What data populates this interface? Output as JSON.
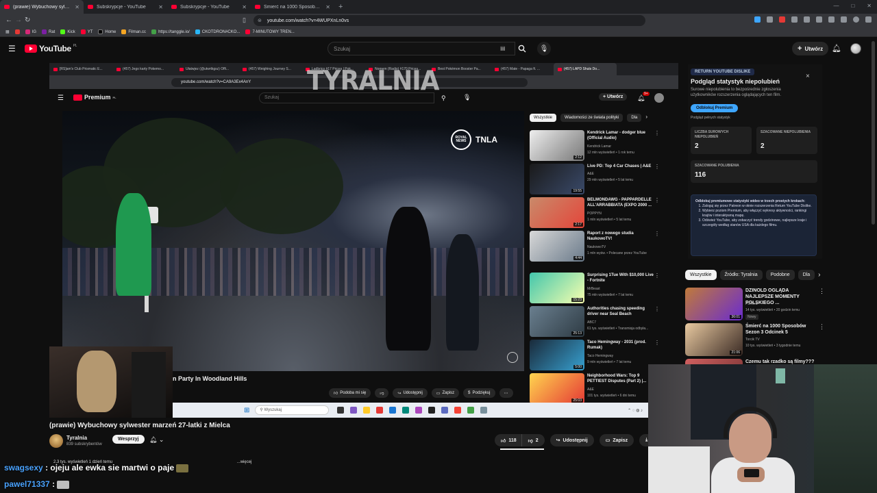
{
  "browser": {
    "tabs": [
      {
        "label": "(prawie) Wybuchowy sylwester...",
        "active": true
      },
      {
        "label": "Subskrypcje - YouTube",
        "active": false
      },
      {
        "label": "Subskrypcje - YouTube",
        "active": false
      },
      {
        "label": "Śmierć na 1000 Sposobów Sezon 3 O...",
        "active": false
      }
    ],
    "url": "youtube.com/watch?v=4WUPXnLn0vs",
    "bookmarks": [
      "IG",
      "Rat",
      "Kick",
      "YT",
      "Home",
      "Filman.cc",
      "https://tanggle.io/",
      "CKOTDRON#CKO...",
      "7-MINUTOWY TREN..."
    ]
  },
  "youtube": {
    "logo_sup": "PL",
    "logo_text": "YouTube",
    "search_placeholder": "Szukaj",
    "create_label": "Utwórz"
  },
  "inner": {
    "tabs": [
      "[RS]am's Club Prismatic E...",
      "(457) Jego karty Pokemo...",
      "Ułatwjez (@utwrtkgsz) Offi...",
      "(457) Weighing Journey S...",
      "Ladbrico #17 Prices | Pok...",
      "Nomem (Radio) #170 Prices...",
      "Best Pokémon Booster Pa...",
      "(457) Mate - Papaga ft. ...",
      "(457) LAPD Shuts Do..."
    ],
    "url": "youtube.com/watch?v=CA9A3Ex4AnY",
    "logo_text": "Premium",
    "logo_sup": "PL",
    "search_placeholder": "Szukaj",
    "create_label": "Utwórz",
    "notif_count": "9+",
    "video_title_partial": "n Party In Woodland Hills",
    "news_badge": "TNLA",
    "news_circle_text": "ROYAL NEWS",
    "actions": [
      "Podoba mi się",
      "Udostępnij",
      "Zapisz",
      "Podziękuj"
    ],
    "chips": [
      "Wszystkie",
      "Wiadomości ze świata polityki",
      "Dla"
    ],
    "recs": [
      {
        "title": "Kendrick Lamar - dodger blue (Official Audio)",
        "channel": "Kendrick Lamar",
        "meta": "12 mln wyświetleń • 1 rok temu",
        "dur": "2:12"
      },
      {
        "title": "Live PD: Top 4 Car Chases | A&E",
        "channel": "A&E",
        "meta": "29 mln wyświetleń • 5 lat temu",
        "dur": "19:55"
      },
      {
        "title": "BELMONDAWG - PAPPARDELLE ALL'ARRABBIATA (EXPO 2000 ...",
        "channel": "POPPYN",
        "meta": "1 mln wyświetleń • 5 lat temu",
        "dur": "2:17"
      },
      {
        "title": "Raport z nowego studia NaukowoTV!",
        "channel": "NaukowoTV",
        "meta": "1 mln wyśw. • Polecane przez YouTube",
        "dur": "4:44"
      },
      {
        "title": "Surprising 1Tue With $10,000 Live - Fortnite",
        "channel": "MrBeast",
        "meta": "75 mln wyświetleń • 7 lat temu",
        "dur": "15:23"
      },
      {
        "title": "Authorities chasing speeding driver near Seal Beach",
        "channel": "ABC7",
        "meta": "61 tys. wyświetleń • Transmisja odbyła...",
        "dur": "25:13"
      },
      {
        "title": "Taco Hemingway - 2031 (prod. Rumak)",
        "channel": "Taco Hemingway",
        "meta": "9 mln wyświetleń • 7 lat temu",
        "dur": "5:00"
      },
      {
        "title": "Neighborhood Wars: Top 9 PETTIEST Disputes (Part 2) |...",
        "channel": "A&E",
        "meta": "101 tys. wyświetleń • 6 dni temu",
        "dur": "25:03"
      }
    ],
    "taskbar_search": "Wyszukaj"
  },
  "watermark": "TYRALNIA",
  "ryd": {
    "badge": "RETURN YOUTUBE DISLIKE",
    "title": "Podgląd statystyk niepolubień",
    "desc": "Surowe niepolubienia to bezpośrednie zgłoszenia użytkowników rozszerzenia oglądających ten film.",
    "button": "Odblokuj Premium",
    "link": "Podgląd pełnych statystyk",
    "raw_label": "LICZBA SUROWYCH NIEPOLUBIEŃ",
    "raw_value": "2",
    "est_label": "SZACOWANE NIEPOLUBIENIA",
    "est_value": "2",
    "likes_label": "SZACOWANE POLUBIENIA",
    "likes_value": "116",
    "premium_head": "Odblokuj premiumowe statystyki wideo w trzech prostych krokach:",
    "steps": [
      "Zaloguj się przez Patreon w oknie rozszerzenia Return YouTube Dislike.",
      "Wybierz poziom Premium, aby włączyć wykresy aktywności, rankingi krajów i interaktywną mapę.",
      "Odśwież YouTube, aby zobaczyć trendy godzinowe, najlepsze kraje i szczegóły według stanów USA dla każdego filmu."
    ]
  },
  "outer_recs": {
    "chips": [
      "Wszystkie",
      "Źródło: Tyralnia",
      "Podobne",
      "Dla"
    ],
    "items": [
      {
        "title": "DZINOLD OGLĄDA NAJLEPSZE MOMENTY POLSKIEGO ...",
        "channel": "PLAN B",
        "meta": "14 tys. wyświetleń • 20 godzin temu",
        "badge": "Nowy",
        "dur": "36:01"
      },
      {
        "title": "Śmierć na 1000 Sposobów Sezon 3 Odcinek 5",
        "channel": "Torcik TV",
        "meta": "10 tys. wyświetleń • 3 tygodnie temu",
        "dur": "21:06"
      },
      {
        "title": "Czemu tak rzadko są filmy???",
        "channel": "",
        "meta": "",
        "dur": ""
      }
    ]
  },
  "video": {
    "title": "(prawie) Wybuchowy sylwester marzeń 27-latki z Mielca",
    "channel": "Tyralnia",
    "subs": "839 subskrybentów",
    "support": "Wesprzyj",
    "likes": "118",
    "dislikes": "2",
    "share": "Udostępnij",
    "save": "Zapisz",
    "download": "Po",
    "desc_stats": "2,3 tys. wyświetleń  1 dzień temu",
    "desc_more": "...więcej"
  },
  "chat": [
    {
      "user": "swagsexy",
      "text": ": ojeju ale ewka sie martwi o paje"
    },
    {
      "user": "pawel71337",
      "text": ":"
    }
  ],
  "colors": {
    "accent": "#ff0033",
    "link": "#3ea6ff",
    "chat_name": "#4aa3ff"
  }
}
